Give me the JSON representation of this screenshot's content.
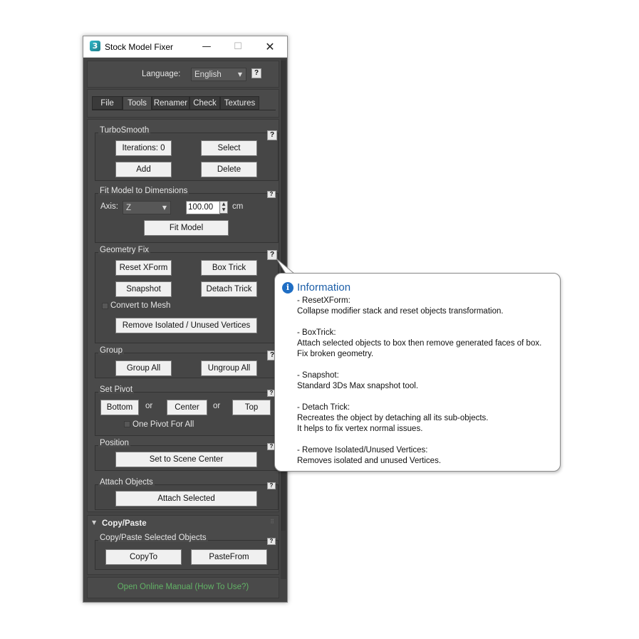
{
  "window": {
    "title": "Stock Model Fixer",
    "icon_glyph": "3",
    "minimize": "—",
    "maximize": "☐",
    "close": "✕"
  },
  "language": {
    "label": "Language:",
    "value": "English",
    "help": "?"
  },
  "tabs": [
    {
      "label": "File"
    },
    {
      "label": "Tools",
      "active": true
    },
    {
      "label": "Renamer"
    },
    {
      "label": "Check"
    },
    {
      "label": "Textures"
    }
  ],
  "turbosmooth": {
    "title": "TurboSmooth",
    "iterations": "Iterations: 0",
    "select": "Select",
    "add": "Add",
    "delete": "Delete"
  },
  "fit_model": {
    "title": "Fit Model to Dimensions",
    "axis_label": "Axis:",
    "axis_value": "Z",
    "dimension_value": "100.00",
    "unit": "cm",
    "button": "Fit Model"
  },
  "geometry_fix": {
    "title": "Geometry Fix",
    "reset_xform": "Reset XForm",
    "box_trick": "Box Trick",
    "snapshot": "Snapshot",
    "detach_trick": "Detach Trick",
    "convert_to_mesh": "Convert to Mesh",
    "remove_vertices": "Remove Isolated / Unused Vertices"
  },
  "group": {
    "title": "Group",
    "group_all": "Group All",
    "ungroup_all": "Ungroup All"
  },
  "set_pivot": {
    "title": "Set Pivot",
    "bottom": "Bottom",
    "or1": "or",
    "center": "Center",
    "or2": "or",
    "top": "Top",
    "one_pivot": "One Pivot For All"
  },
  "position": {
    "title": "Position",
    "button": "Set to Scene Center"
  },
  "attach": {
    "title": "Attach Objects",
    "button": "Attach Selected"
  },
  "copy_paste": {
    "rollout_title": "Copy/Paste",
    "group_title": "Copy/Paste Selected Objects",
    "copy_to": "CopyTo",
    "paste_from": "PasteFrom"
  },
  "manual": {
    "link": "Open Online Manual (How To Use?)"
  },
  "tooltip": {
    "title": "Information",
    "lines": [
      "- ResetXForm:",
      "Collapse modifier stack and reset objects transformation.",
      "- BoxTrick:",
      "Attach  selected objects to box then remove generated faces of box.",
      "Fix broken geometry.",
      "- Snapshot:",
      "Standard 3Ds Max snapshot tool.",
      "- Detach Trick:",
      "Recreates the object by detaching all its sub-objects.",
      "It helps to fix vertex normal issues.",
      "- Remove Isolated/Unused Vertices:",
      "Removes isolated and unused Vertices."
    ]
  },
  "colors": {
    "panel_bg": "#4a4a4a",
    "button_bg": "#f0f0f0",
    "link_green": "#62b266",
    "info_blue": "#1d5fa8"
  }
}
